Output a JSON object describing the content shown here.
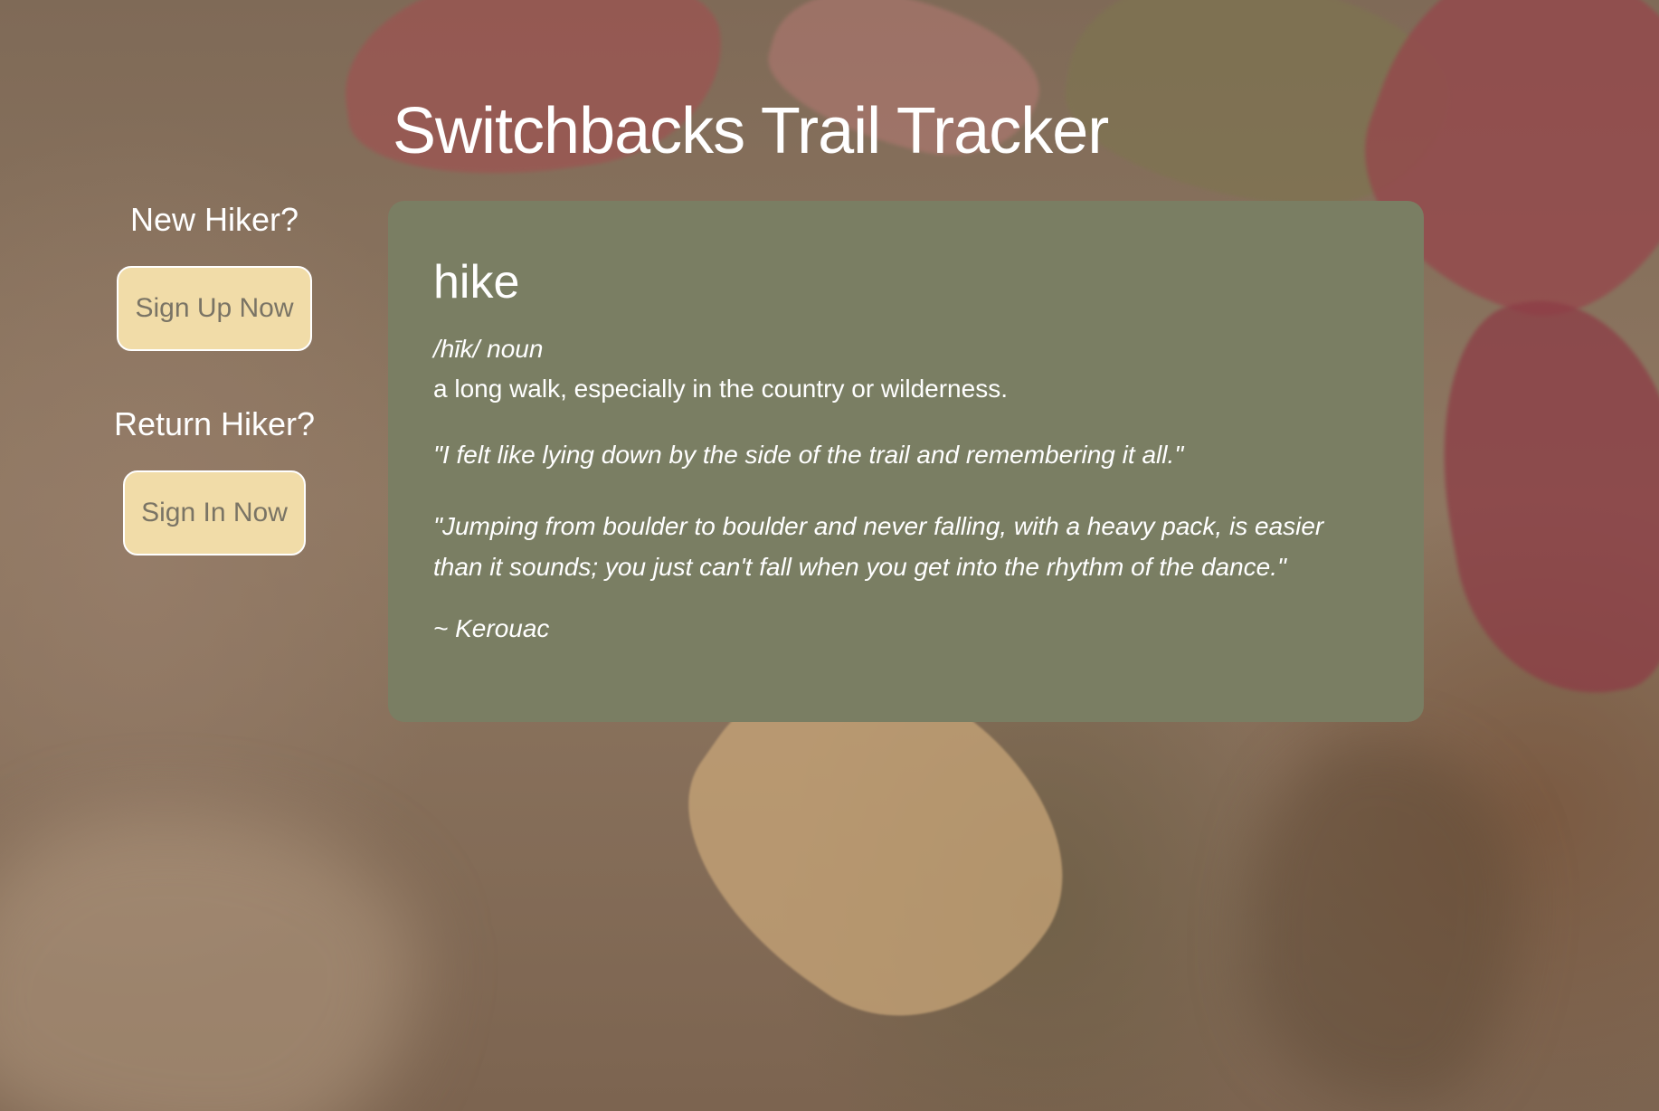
{
  "header": {
    "title": "Switchbacks Trail Tracker"
  },
  "sidebar": {
    "new_hiker": {
      "heading": "New Hiker?",
      "button_label": "Sign Up Now"
    },
    "return_hiker": {
      "heading": "Return Hiker?",
      "button_label": "Sign In Now"
    }
  },
  "definition_card": {
    "word": "hike",
    "pronunciation": "/hīk/  noun",
    "definition": "a long walk, especially in the country or wilderness.",
    "quotes": [
      "\"I felt like lying down by the side of the trail and remembering it all.\"",
      "\"Jumping from boulder to boulder and never falling, with a heavy pack, is easier than it sounds; you just can't fall when you get into the rhythm of the dance.\""
    ],
    "attribution": "~ Kerouac"
  },
  "colors": {
    "card_background": "#7a7e63",
    "button_background": "#f1dca8",
    "button_text": "#7a7465",
    "text": "#ffffff"
  }
}
